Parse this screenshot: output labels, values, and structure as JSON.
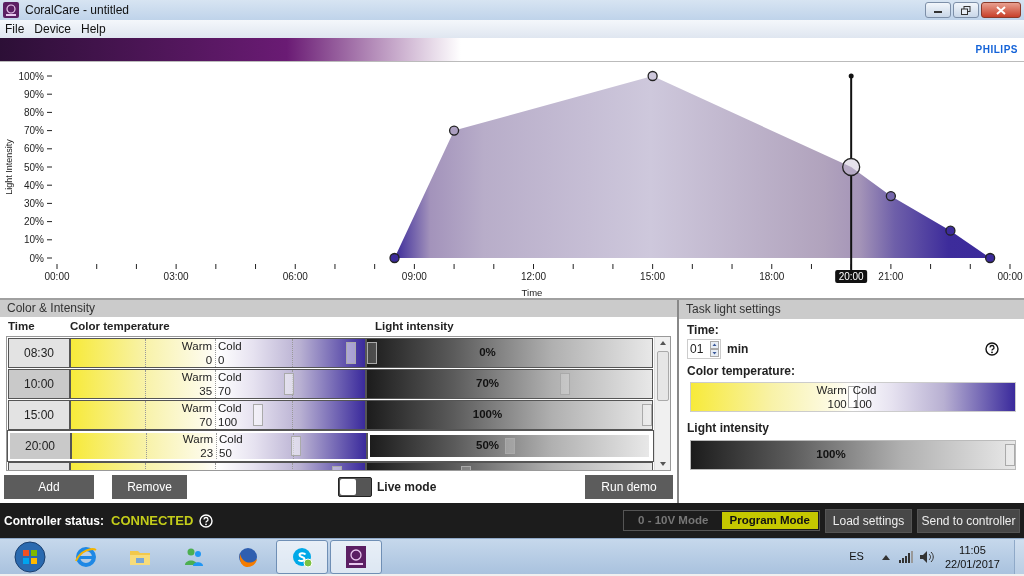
{
  "window": {
    "title": "CoralCare - untitled"
  },
  "menu": [
    "File",
    "Device",
    "Help"
  ],
  "brand": "PHILIPS",
  "chart": {
    "chart_data": {
      "type": "area",
      "xlabel": "Time",
      "ylabel": "Light Intensity",
      "x": [
        8.5,
        10,
        15,
        20,
        21,
        22.5,
        23.5
      ],
      "series": [
        {
          "color": "#3b2a9a",
          "values": [
            0,
            70,
            100,
            50,
            34,
            15,
            0
          ]
        }
      ],
      "xlim": [
        0,
        24
      ],
      "ylim": [
        0,
        100
      ],
      "xticks": [
        {
          "value": 0,
          "label": "00:00"
        },
        {
          "value": 3,
          "label": "03:00"
        },
        {
          "value": 6,
          "label": "06:00"
        },
        {
          "value": 9,
          "label": "09:00"
        },
        {
          "value": 12,
          "label": "12:00"
        },
        {
          "value": 15,
          "label": "15:00"
        },
        {
          "value": 18,
          "label": "18:00"
        },
        {
          "value": 21,
          "label": "21:00"
        },
        {
          "value": 24,
          "label": "00:00"
        }
      ],
      "yticks": [
        {
          "value": 0,
          "label": "0%"
        },
        {
          "value": 10,
          "label": "10%"
        },
        {
          "value": 20,
          "label": "20%"
        },
        {
          "value": 30,
          "label": "30%"
        },
        {
          "value": 40,
          "label": "40%"
        },
        {
          "value": 50,
          "label": "50%"
        },
        {
          "value": 60,
          "label": "60%"
        },
        {
          "value": 70,
          "label": "70%"
        },
        {
          "value": 80,
          "label": "80%"
        },
        {
          "value": 90,
          "label": "90%"
        },
        {
          "value": 100,
          "label": "100%"
        }
      ],
      "ref_lines": [
        {
          "axis": "x",
          "value": 20,
          "label": "20:00"
        }
      ]
    }
  },
  "color_intensity": {
    "title": "Color & Intensity",
    "columns": [
      "Time",
      "Color temperature",
      "Light intensity"
    ],
    "rows": [
      {
        "time": "08:30",
        "selected": false,
        "color_temperature": {
          "warm_label": "Warm",
          "warm": "0",
          "cold_label": "Cold",
          "cold": "0",
          "level": 0.97
        },
        "intensity": {
          "reading": "0%",
          "level": 0
        }
      },
      {
        "time": "10:00",
        "selected": false,
        "color_temperature": {
          "warm_label": "Warm",
          "warm": "35",
          "cold_label": "Cold",
          "cold": "70",
          "level": 0.75
        },
        "intensity": {
          "reading": "70%",
          "level": 0.7
        }
      },
      {
        "time": "15:00",
        "selected": false,
        "color_temperature": {
          "warm_label": "Warm",
          "warm": "70",
          "cold_label": "Cold",
          "cold": "100",
          "level": 0.64
        },
        "intensity": {
          "reading": "100%",
          "level": 1
        }
      },
      {
        "time": "20:00",
        "selected": true,
        "color_temperature": {
          "warm_label": "Warm",
          "warm": "23",
          "cold_label": "Cold",
          "cold": "50",
          "level": 0.77
        },
        "intensity": {
          "reading": "50%",
          "level": 0.5
        }
      },
      {
        "selected": false,
        "color_temperature": {
          "level": 0.92
        },
        "intensity": {
          "level": 0.34
        }
      }
    ],
    "buttons": [
      "Add",
      "Remove"
    ],
    "live_mode": {
      "label": "Live mode",
      "on": false
    },
    "run_button": "Run demo"
  },
  "task_light": {
    "title": "Task light settings",
    "time_label": "Time:",
    "time_value": "01",
    "time_unit": "min",
    "color_label": "Color temperature:",
    "color_temperature": {
      "warm_label": "Warm",
      "warm": "100",
      "cold_label": "Cold",
      "cold": "100",
      "level": 0.5
    },
    "intensity_label": "Light intensity",
    "intensity": {
      "reading": "100%",
      "level": 1
    }
  },
  "status_bar": {
    "label": "Controller status:",
    "status": "CONNECTED",
    "modes": [
      {
        "label": "0 - 10V Mode",
        "selected": false
      },
      {
        "label": "Program Mode",
        "selected": true
      }
    ],
    "buttons": [
      "Load settings",
      "Send to controller"
    ]
  },
  "taskbar": {
    "apps": [
      {
        "kind": "browser-e",
        "active": false
      },
      {
        "kind": "folder",
        "active": false
      },
      {
        "kind": "people",
        "active": false
      },
      {
        "kind": "fox",
        "active": false
      },
      {
        "kind": "chat",
        "active": true
      },
      {
        "kind": "coral",
        "active": true
      }
    ],
    "language": "ES",
    "time": "11:05",
    "date": "22/01/2017"
  }
}
